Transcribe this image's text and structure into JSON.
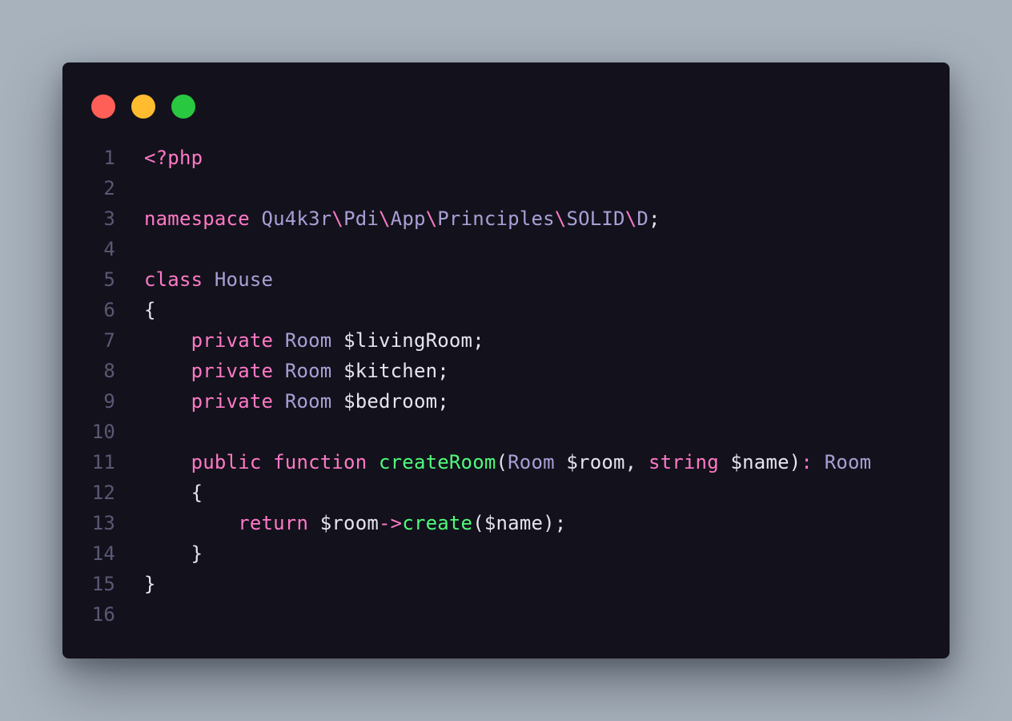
{
  "window_controls": [
    {
      "name": "close-button",
      "color": "#ff5f57"
    },
    {
      "name": "minimize-button",
      "color": "#febc2e"
    },
    {
      "name": "maximize-button",
      "color": "#28c840"
    }
  ],
  "colors": {
    "background": "#a8b2bd",
    "editor_background": "#13121c",
    "line_number": "#5a5874",
    "keyword": "#ff79c6",
    "type": "#a99fd6",
    "function": "#50fa7b",
    "plain": "#e6e4ee"
  },
  "code": {
    "language": "php",
    "lines": [
      {
        "number": "1",
        "tokens": [
          {
            "text": "<?php",
            "kind": "keyword"
          }
        ]
      },
      {
        "number": "2",
        "tokens": []
      },
      {
        "number": "3",
        "tokens": [
          {
            "text": "namespace ",
            "kind": "keyword"
          },
          {
            "text": "Qu4k3r",
            "kind": "type"
          },
          {
            "text": "\\",
            "kind": "keyword"
          },
          {
            "text": "Pdi",
            "kind": "type"
          },
          {
            "text": "\\",
            "kind": "keyword"
          },
          {
            "text": "App",
            "kind": "type"
          },
          {
            "text": "\\",
            "kind": "keyword"
          },
          {
            "text": "Principles",
            "kind": "type"
          },
          {
            "text": "\\",
            "kind": "keyword"
          },
          {
            "text": "SOLID",
            "kind": "type"
          },
          {
            "text": "\\",
            "kind": "keyword"
          },
          {
            "text": "D",
            "kind": "type"
          },
          {
            "text": ";",
            "kind": "plain"
          }
        ]
      },
      {
        "number": "4",
        "tokens": []
      },
      {
        "number": "5",
        "tokens": [
          {
            "text": "class ",
            "kind": "keyword"
          },
          {
            "text": "House",
            "kind": "type"
          }
        ]
      },
      {
        "number": "6",
        "tokens": [
          {
            "text": "{",
            "kind": "plain"
          }
        ]
      },
      {
        "number": "7",
        "tokens": [
          {
            "text": "    ",
            "kind": "plain"
          },
          {
            "text": "private ",
            "kind": "keyword"
          },
          {
            "text": "Room ",
            "kind": "type"
          },
          {
            "text": "$livingRoom;",
            "kind": "plain"
          }
        ]
      },
      {
        "number": "8",
        "tokens": [
          {
            "text": "    ",
            "kind": "plain"
          },
          {
            "text": "private ",
            "kind": "keyword"
          },
          {
            "text": "Room ",
            "kind": "type"
          },
          {
            "text": "$kitchen;",
            "kind": "plain"
          }
        ]
      },
      {
        "number": "9",
        "tokens": [
          {
            "text": "    ",
            "kind": "plain"
          },
          {
            "text": "private ",
            "kind": "keyword"
          },
          {
            "text": "Room ",
            "kind": "type"
          },
          {
            "text": "$bedroom;",
            "kind": "plain"
          }
        ]
      },
      {
        "number": "10",
        "tokens": []
      },
      {
        "number": "11",
        "tokens": [
          {
            "text": "    ",
            "kind": "plain"
          },
          {
            "text": "public function ",
            "kind": "keyword"
          },
          {
            "text": "createRoom",
            "kind": "function"
          },
          {
            "text": "(",
            "kind": "plain"
          },
          {
            "text": "Room ",
            "kind": "type"
          },
          {
            "text": "$room, ",
            "kind": "plain"
          },
          {
            "text": "string ",
            "kind": "keyword"
          },
          {
            "text": "$name)",
            "kind": "plain"
          },
          {
            "text": ": ",
            "kind": "keyword"
          },
          {
            "text": "Room",
            "kind": "type"
          }
        ]
      },
      {
        "number": "12",
        "tokens": [
          {
            "text": "    ",
            "kind": "plain"
          },
          {
            "text": "{",
            "kind": "plain"
          }
        ]
      },
      {
        "number": "13",
        "tokens": [
          {
            "text": "        ",
            "kind": "plain"
          },
          {
            "text": "return ",
            "kind": "keyword"
          },
          {
            "text": "$room",
            "kind": "plain"
          },
          {
            "text": "->",
            "kind": "keyword"
          },
          {
            "text": "create",
            "kind": "function"
          },
          {
            "text": "($name);",
            "kind": "plain"
          }
        ]
      },
      {
        "number": "14",
        "tokens": [
          {
            "text": "    ",
            "kind": "plain"
          },
          {
            "text": "}",
            "kind": "plain"
          }
        ]
      },
      {
        "number": "15",
        "tokens": [
          {
            "text": "}",
            "kind": "plain"
          }
        ]
      },
      {
        "number": "16",
        "tokens": []
      }
    ]
  }
}
